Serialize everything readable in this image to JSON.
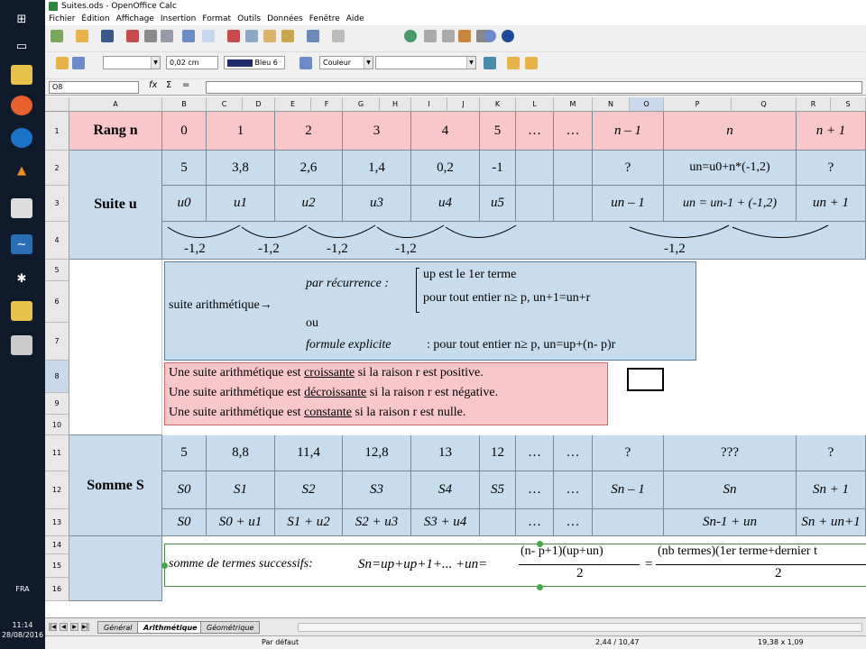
{
  "window": {
    "title": "Suites.ods - OpenOffice Calc"
  },
  "menu": [
    "Fichier",
    "Édition",
    "Affichage",
    "Insertion",
    "Format",
    "Outils",
    "Données",
    "Fenêtre",
    "Aide"
  ],
  "toolbar2": {
    "line_width": "0,02 cm",
    "line_color": "Bleu 6",
    "area_style": "Couleur"
  },
  "formula_bar": {
    "cell_ref": "O8",
    "fx": "fx",
    "sigma": "Σ",
    "eq": "=",
    "content": ""
  },
  "columns": [
    "A",
    "B",
    "C",
    "D",
    "E",
    "F",
    "G",
    "H",
    "I",
    "J",
    "K",
    "L",
    "M",
    "N",
    "O",
    "P",
    "Q",
    "R",
    "S"
  ],
  "rows": [
    "1",
    "2",
    "3",
    "4",
    "5",
    "6",
    "7",
    "8",
    "9",
    "10",
    "11",
    "12",
    "13",
    "14",
    "15",
    "16"
  ],
  "labels": {
    "rang": "Rang n",
    "suite": "Suite u",
    "somme": "Somme S"
  },
  "rang_values": [
    "0",
    "1",
    "2",
    "3",
    "4",
    "5",
    "…",
    "…",
    "n – 1",
    "n",
    "n + 1"
  ],
  "suite_values": [
    "5",
    "3,8",
    "2,6",
    "1,4",
    "0,2",
    "-1",
    "",
    "",
    "?",
    "un=u0+n*(-1,2)",
    "?"
  ],
  "suite_terms": [
    "u0",
    "u1",
    "u2",
    "u3",
    "u4",
    "u5",
    "",
    "",
    "un – 1",
    "un = un-1 + (-1,2)",
    "un + 1"
  ],
  "differences": [
    "-1,2",
    "-1,2",
    "-1,2",
    "-1,2",
    "-1,2"
  ],
  "arith": {
    "label": "suite arithmétique→",
    "recurrence": "par récurrence :",
    "first_term": "up  est le 1er  terme",
    "all_int": "pour tout entier  n≥ p,  un+1=un+r",
    "ou": "ou",
    "explicit": "formule explicite",
    "explicit_rest": ": pour tout entier  n≥ p,  un=up+(n- p)r"
  },
  "rules": [
    {
      "a": "Une suite arithmétique est ",
      "w": "croissante",
      "b": "  si la raison  r  est positive."
    },
    {
      "a": "Une suite arithmétique est ",
      "w": "décroissante",
      "b": "  si la raison  r  est négative."
    },
    {
      "a": "Une suite arithmétique est ",
      "w": "constante",
      "b": "  si la raison  r  est nulle."
    }
  ],
  "somme_values": [
    "5",
    "8,8",
    "11,4",
    "12,8",
    "13",
    "12",
    "…",
    "…",
    "?",
    "???",
    "?"
  ],
  "somme_terms": [
    "S0",
    "S1",
    "S2",
    "S3",
    "S4",
    "S5",
    "…",
    "…",
    "Sn – 1",
    "Sn",
    "Sn + 1"
  ],
  "somme_recur": [
    "S0",
    "S0 + u1",
    "S1 + u2",
    "S2 + u3",
    "S3 + u4",
    "",
    "…",
    "…",
    "",
    "Sn-1 + un",
    "Sn + un+1"
  ],
  "sum_formula": {
    "label": "somme de termes successifs:",
    "lhs": "Sn=up+up+1+... +un=",
    "num1": "(n- p+1)(up+un)",
    "den1": "2",
    "eq": "=",
    "num2": "(nb termes)(1er  terme+dernier t",
    "den2": "2"
  },
  "sheets": [
    "Général",
    "Arithmétique",
    "Géométrique"
  ],
  "status": {
    "style": "Par défaut",
    "pos": "2,44 / 10,47",
    "size": "19,38 x 1,09"
  },
  "clock": {
    "time": "11:14",
    "date": "28/08/2016"
  },
  "lang": "FRA"
}
